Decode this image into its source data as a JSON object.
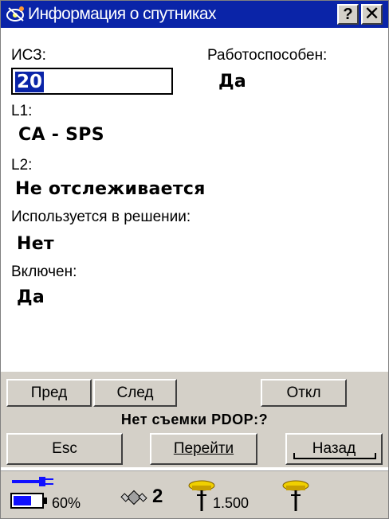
{
  "window": {
    "title": "Информация о спутниках",
    "help_label": "?",
    "close_label": "✕"
  },
  "fields": {
    "isz_label": "ИСЗ:",
    "isz_value": "20",
    "healthy_label": "Работоспособен:",
    "healthy_value": "Да",
    "l1_label": "L1:",
    "l1_value": "CA - SPS",
    "l2_label": "L2:",
    "l2_value": "Не отслеживается",
    "used_label": "Используется в решении:",
    "used_value": "Нет",
    "enabled_label": "Включен:",
    "enabled_value": "Да"
  },
  "buttons": {
    "prev": "Пред",
    "next": "След",
    "disable": "Откл",
    "esc": "Esc",
    "goto": "Перейти",
    "back": "Назад"
  },
  "status_line": "Нет съемки PDOP:?",
  "statusbar": {
    "battery_percent": "60%",
    "satellites_count": "2",
    "antenna_height": "1.500"
  },
  "colors": {
    "titlebar": "#0a24a8",
    "panel": "#d4d0c8",
    "battery_blue": "#1010ff",
    "antenna_yellow": "#f0d000"
  }
}
